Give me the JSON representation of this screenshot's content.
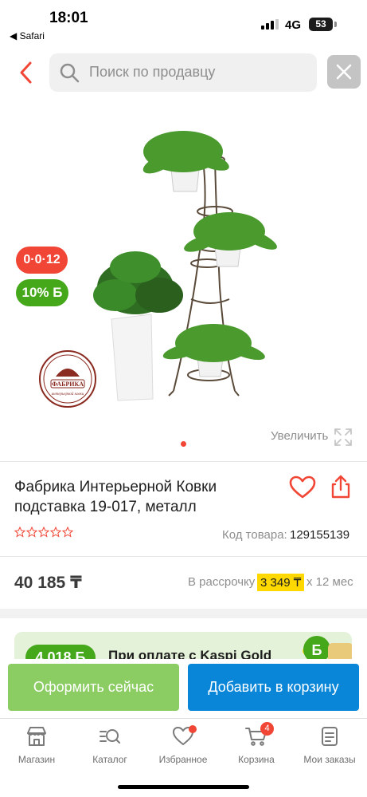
{
  "status_bar": {
    "time": "18:01",
    "back_app": "◀ Safari",
    "network": "4G",
    "battery": "53"
  },
  "header": {
    "search_placeholder": "Поиск по продавцу"
  },
  "gallery": {
    "badge_installment": "0·0·12",
    "badge_bonus": "10% Б",
    "zoom_label": "Увеличить",
    "current_slide": 1,
    "total_slides": 1
  },
  "product": {
    "title": "Фабрика Интерьерной Ковки подставка 19-017, металл",
    "rating": 0,
    "code_label": "Код товара:",
    "code_value": "129155139",
    "price": "40 185 ₸",
    "installment_label": "В рассрочку",
    "installment_amount": "3 349 ₸",
    "installment_months": "x 12 мес"
  },
  "promo": {
    "amount": "4 018 Б",
    "text": "При оплате с Kaspi Gold"
  },
  "actions": {
    "buy_now": "Оформить сейчас",
    "add_to_cart": "Добавить в корзину"
  },
  "tabbar": {
    "items": [
      {
        "label": "Магазин",
        "icon": "store-icon"
      },
      {
        "label": "Каталог",
        "icon": "catalog-search-icon"
      },
      {
        "label": "Избранное",
        "icon": "heart-icon"
      },
      {
        "label": "Корзина",
        "icon": "cart-icon",
        "badge": "4"
      },
      {
        "label": "Мои заказы",
        "icon": "orders-icon"
      }
    ]
  },
  "colors": {
    "accent_red": "#f14635",
    "bonus_green": "#45a81a",
    "buy_now_green": "#8ccd63",
    "cart_blue": "#0a86d8",
    "installment_yellow": "#ffd800"
  }
}
